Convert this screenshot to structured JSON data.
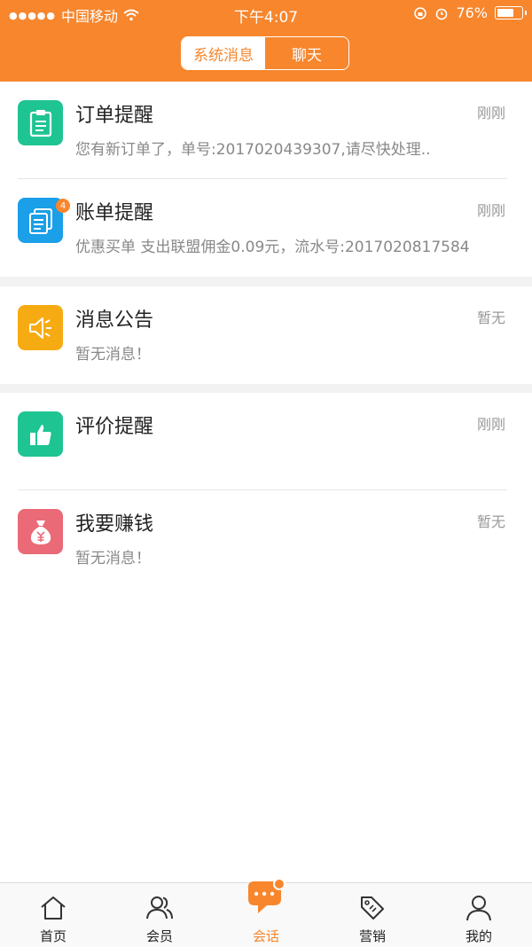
{
  "status_bar": {
    "carrier": "中国移动",
    "time": "下午4:07",
    "battery": "76%",
    "battery_level": 0.76
  },
  "header": {
    "tabs": [
      {
        "label": "系统消息",
        "active": true
      },
      {
        "label": "聊天",
        "active": false
      }
    ]
  },
  "messages": [
    {
      "title": "订单提醒",
      "time": "刚刚",
      "preview": "您有新订单了，单号:2017020439307,请尽快处理..",
      "icon": "clipboard-icon",
      "color": "#1fc493"
    },
    {
      "title": "账单提醒",
      "time": "刚刚",
      "preview": "优惠买单 支出联盟佣金0.09元，流水号:2017020817584",
      "icon": "bill-icon",
      "color": "#1a9fe8",
      "badge": "4"
    },
    {
      "title": "消息公告",
      "time": "暂无",
      "preview": "暂无消息！",
      "icon": "speaker-icon",
      "color": "#f7ab12"
    },
    {
      "title": "评价提醒",
      "time": "刚刚",
      "preview": "",
      "icon": "thumbs-up-icon",
      "color": "#1fc493"
    },
    {
      "title": "我要赚钱",
      "time": "暂无",
      "preview": "暂无消息！",
      "icon": "money-bag-icon",
      "color": "#eb6a77"
    }
  ],
  "tabbar": {
    "items": [
      {
        "label": "首页",
        "icon": "home-icon"
      },
      {
        "label": "会员",
        "icon": "members-icon"
      },
      {
        "label": "会话",
        "icon": "chat-icon",
        "active": true
      },
      {
        "label": "营销",
        "icon": "tag-icon"
      },
      {
        "label": "我的",
        "icon": "profile-icon"
      }
    ]
  },
  "colors": {
    "accent": "#f7862d"
  }
}
